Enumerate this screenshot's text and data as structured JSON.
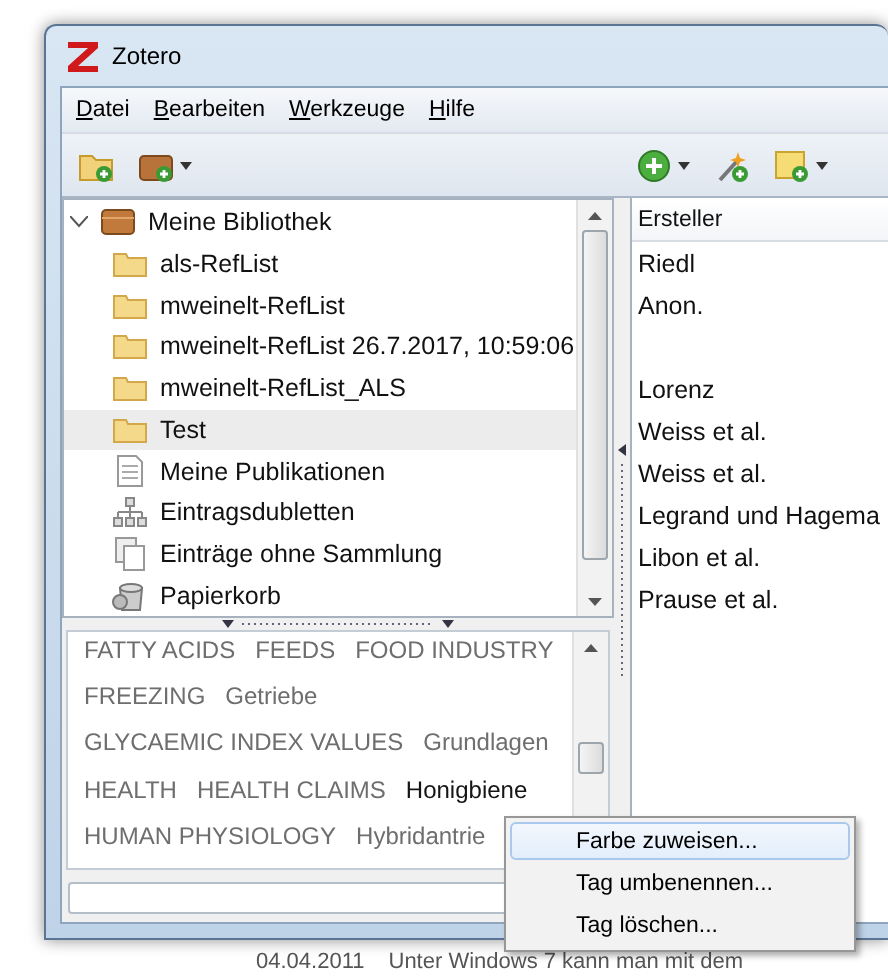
{
  "window": {
    "title": "Zotero"
  },
  "menu": [
    {
      "label": "Datei"
    },
    {
      "label": "Bearbeiten"
    },
    {
      "label": "Werkzeuge"
    },
    {
      "label": "Hilfe"
    }
  ],
  "toolbar": {
    "left": [
      {
        "kind": "new-collection",
        "dropdown": false
      },
      {
        "kind": "new-library",
        "dropdown": true
      }
    ],
    "right": [
      {
        "kind": "new-item",
        "dropdown": true
      },
      {
        "kind": "wand",
        "dropdown": false
      },
      {
        "kind": "new-note",
        "dropdown": true
      }
    ]
  },
  "collections": [
    {
      "label": "Meine Bibliothek",
      "kind": "library",
      "expanded": true,
      "selected": false,
      "children": [
        {
          "label": "als-RefList",
          "kind": "folder",
          "selected": false
        },
        {
          "label": "mweinelt-RefList",
          "kind": "folder",
          "selected": false
        },
        {
          "label": "mweinelt-RefList 26.7.2017, 10:59:06",
          "kind": "folder",
          "selected": false
        },
        {
          "label": "mweinelt-RefList_ALS",
          "kind": "folder",
          "selected": false
        },
        {
          "label": "Test",
          "kind": "folder",
          "selected": true
        },
        {
          "label": "Meine Publikationen",
          "kind": "document",
          "selected": false
        },
        {
          "label": "Eintragsdubletten",
          "kind": "duplicates",
          "selected": false
        },
        {
          "label": "Einträge ohne Sammlung",
          "kind": "unfiled",
          "selected": false
        },
        {
          "label": "Papierkorb",
          "kind": "trash",
          "selected": false
        }
      ]
    }
  ],
  "items": {
    "columns": [
      "Ersteller"
    ],
    "rows": [
      {
        "creator": "Riedl"
      },
      {
        "creator": "Anon."
      },
      {},
      {
        "creator": "Lorenz"
      },
      {
        "creator": "Weiss et al."
      },
      {
        "creator": "Weiss et al."
      },
      {
        "creator": "Legrand und Hagema"
      },
      {
        "creator": "Libon et al."
      },
      {
        "creator": "Prause et al."
      }
    ]
  },
  "tag_rows": [
    [
      {
        "label": "FATTY ACIDS",
        "selected": false
      },
      {
        "label": "FEEDS",
        "selected": false
      },
      {
        "label": "FOOD INDUSTRY",
        "selected": false
      }
    ],
    [
      {
        "label": "FREEZING",
        "selected": false
      },
      {
        "label": "Getriebe",
        "selected": false
      }
    ],
    [
      {
        "label": "GLYCAEMIC INDEX VALUES",
        "selected": false
      },
      {
        "label": "Grundlagen",
        "selected": false
      }
    ],
    [
      {
        "label": "HEALTH",
        "selected": false
      },
      {
        "label": "HEALTH CLAIMS",
        "selected": false
      },
      {
        "label": "Honigbiene",
        "selected": true
      }
    ],
    [
      {
        "label": "HUMAN PHYSIOLOGY",
        "selected": false
      },
      {
        "label": "Hybridantrie",
        "selected": false
      }
    ]
  ],
  "context_menu": [
    {
      "label": "Farbe zuweisen...",
      "selected": true
    },
    {
      "label": "Tag umbenennen...",
      "selected": false
    },
    {
      "label": "Tag löschen...",
      "selected": false
    }
  ],
  "background_texts": [
    "04.04.2011",
    "Unter Windows 7 kann man mit dem"
  ]
}
